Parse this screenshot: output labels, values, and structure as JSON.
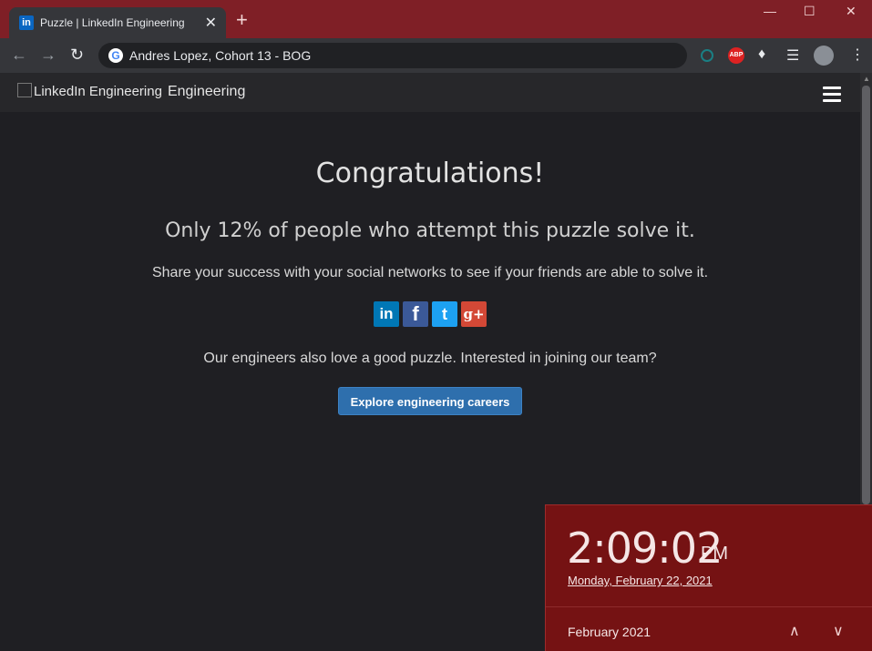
{
  "browser": {
    "tab_title": "Puzzle | LinkedIn Engineering",
    "tab_favicon": "in",
    "new_tab": "+",
    "close_tab": "✕",
    "address": "Andres Lopez, Cohort 13 - BOG",
    "extensions": {
      "abp": "ABP"
    }
  },
  "site": {
    "logo_alt": "LinkedIn Engineering",
    "logo_word": "Engineering"
  },
  "main": {
    "heading": "Congratulations!",
    "subheading": "Only 12% of people who attempt this puzzle solve it.",
    "share_text": "Share your success with your social networks to see if your friends are able to solve it.",
    "social": {
      "linkedin": "in",
      "facebook": "f",
      "twitter": "t",
      "google": "g+"
    },
    "careers_text": "Our engineers also love a good puzzle. Interested in joining our team?",
    "cta_label": "Explore engineering careers"
  },
  "clock": {
    "time": "2:09:02",
    "ampm": "PM",
    "date": "Monday, February 22, 2021",
    "month": "February 2021"
  },
  "colors": {
    "titlebar": "#7f1f26",
    "clock_bg": "#751213",
    "cta": "#2e6fad"
  }
}
